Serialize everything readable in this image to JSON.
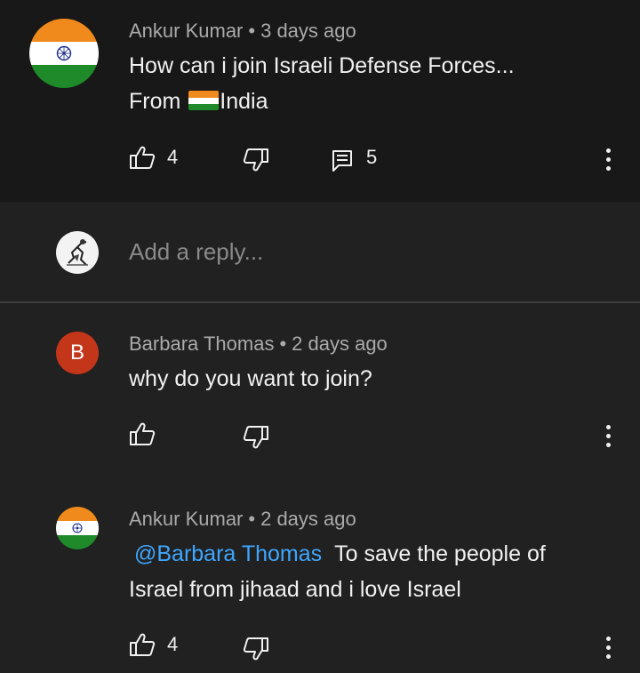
{
  "colors": {
    "background": "#212121",
    "top_comment_background": "#181818",
    "mention": "#3ea6ff",
    "avatar_b": "#c4361a",
    "saffron": "#f08a1c",
    "green": "#1f8a2a"
  },
  "top_comment": {
    "author": "Ankur Kumar",
    "separator": "•",
    "time": "3 days ago",
    "line1": "How can i join Israeli Defense Forces...",
    "line2_prefix": "From ",
    "line2_suffix": "India",
    "likes": "4",
    "replies": "5",
    "avatar_icon": "india-flag-avatar"
  },
  "reply_box": {
    "placeholder": "Add a reply..."
  },
  "replies": [
    {
      "author": "Barbara Thomas",
      "separator": "•",
      "time": "2 days ago",
      "text": "why do you want to join?",
      "avatar_letter": "B"
    },
    {
      "author": "Ankur Kumar",
      "separator": "•",
      "time": "2 days ago",
      "mention": "@Barbara Thomas",
      "text_line1": "To save the people of",
      "text_line2": "Israel from jihaad and i love Israel",
      "likes": "4"
    }
  ]
}
